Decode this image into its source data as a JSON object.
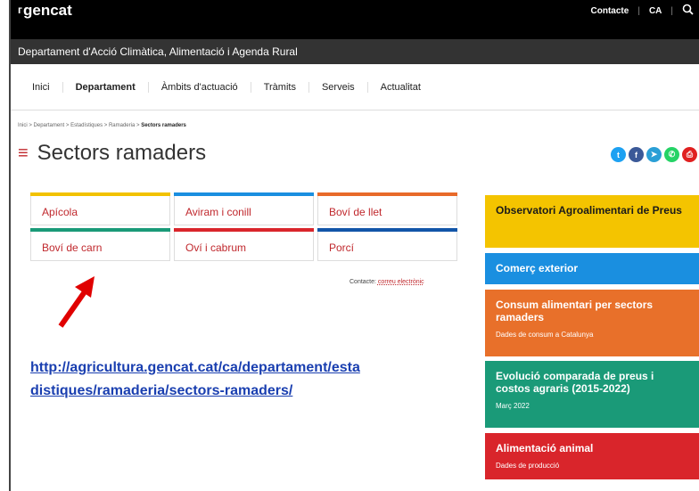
{
  "header": {
    "logo_mark": "ᴦ",
    "logo_text": "gencat",
    "contact": "Contacte",
    "language": "CA",
    "sep1": "|",
    "sep2": "|",
    "search_icon": "search-icon",
    "department": "Departament d'Acció Climàtica, Alimentació i Agenda Rural"
  },
  "nav": {
    "items": [
      "Inici",
      "Departament",
      "Àmbits d'actuació",
      "Tràmits",
      "Serveis",
      "Actualitat"
    ],
    "active": "Departament"
  },
  "breadcrumb": {
    "items": [
      "Inici",
      "Departament",
      "Estadístiques",
      "Ramaderia"
    ],
    "current": "Sectors ramaders",
    "sep": ">"
  },
  "page": {
    "menu_icon": "≡",
    "title": "Sectors ramaders"
  },
  "social": [
    {
      "icon": "twitter-icon",
      "glyph": "t",
      "color": "#1da1f2"
    },
    {
      "icon": "facebook-icon",
      "glyph": "f",
      "color": "#3b5998"
    },
    {
      "icon": "telegram-icon",
      "glyph": "➤",
      "color": "#2a9fd6"
    },
    {
      "icon": "whatsapp-icon",
      "glyph": "✆",
      "color": "#25d366"
    },
    {
      "icon": "print-icon",
      "glyph": "⎙",
      "color": "#e02020"
    }
  ],
  "sectors": [
    {
      "label": "Apícola",
      "color": "#f2c200"
    },
    {
      "label": "Aviram i conill",
      "color": "#1a8fe0"
    },
    {
      "label": "Boví de llet",
      "color": "#e86a2a"
    },
    {
      "label": "Boví de carn",
      "color": "#1a9a78"
    },
    {
      "label": "Oví i cabrum",
      "color": "#d9252b"
    },
    {
      "label": "Porcí",
      "color": "#1255a8"
    }
  ],
  "contact_line": {
    "label": "Contacte:",
    "link": "correu electrònic"
  },
  "annotation": {
    "arrow": "red-arrow-icon",
    "arrow_color": "#e00000",
    "url_line1": "http://agricultura.gencat.cat/ca/departament/esta",
    "url_line2": "distiques/ramaderia/sectors-ramaders/"
  },
  "sidebar": [
    {
      "title": "Observatori Agroalimentari de Preus",
      "subtitle": "",
      "color": "#f4c400",
      "text_color": "#1a1a1a"
    },
    {
      "title": "Comerç exterior",
      "subtitle": "",
      "color": "#1a8fe0",
      "text_color": "#ffffff"
    },
    {
      "title": "Consum alimentari per sectors ramaders",
      "subtitle": "Dades de consum a Catalunya",
      "color": "#e8702a",
      "text_color": "#ffffff"
    },
    {
      "title": "Evolució comparada de preus i costos agraris (2015-2022)",
      "subtitle": "Març 2022",
      "color": "#1a9a78",
      "text_color": "#ffffff"
    },
    {
      "title": "Alimentació animal",
      "subtitle": "Dades de producció",
      "color": "#d9252b",
      "text_color": "#ffffff"
    }
  ]
}
